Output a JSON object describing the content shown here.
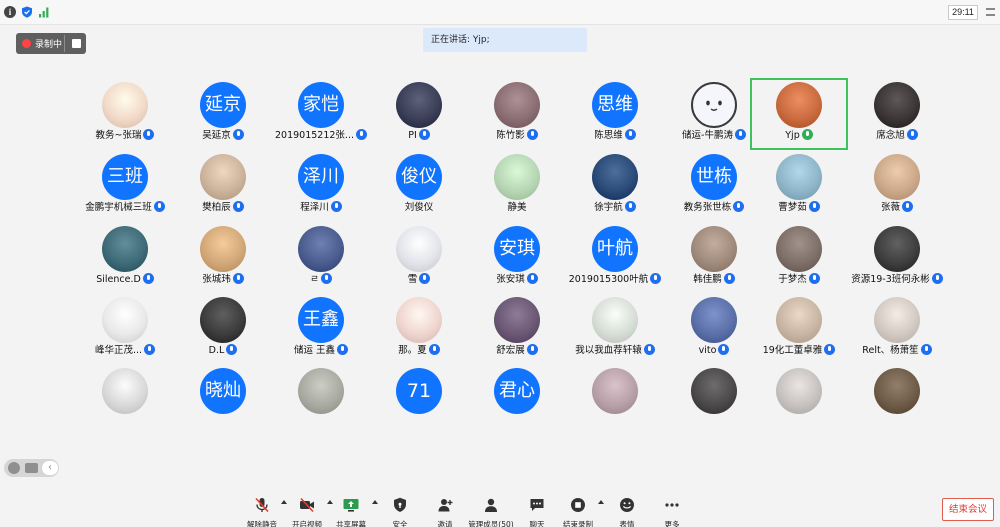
{
  "status_bar": {
    "timer": "29:11"
  },
  "recording": {
    "label": "录制中"
  },
  "speaking": {
    "text": "正在讲话: Yjp;"
  },
  "participants": [
    {
      "name": "教务~张瑞",
      "avatar": "photo",
      "color": "#f2d9c8"
    },
    {
      "name": "吴延京",
      "avatar": "text",
      "text": "延京"
    },
    {
      "name": "2019015212张...",
      "avatar": "text",
      "text": "家恺"
    },
    {
      "name": "PI",
      "avatar": "photo",
      "color": "#3a3f57"
    },
    {
      "name": "陈竹影",
      "avatar": "photo",
      "color": "#8a6e73"
    },
    {
      "name": "陈思维",
      "avatar": "text",
      "text": "思维"
    },
    {
      "name": "储运-牛鹏涛",
      "avatar": "face",
      "color": "#f4f6fb"
    },
    {
      "name": "Yjp",
      "avatar": "photo",
      "color": "#c96b3f",
      "active": true
    },
    {
      "name": "席念旭",
      "avatar": "photo",
      "color": "#3b3536"
    },
    {
      "name": "金鹏宇机械三班",
      "avatar": "text",
      "text": "三班"
    },
    {
      "name": "樊柏辰",
      "avatar": "photo",
      "color": "#cbb39c"
    },
    {
      "name": "程泽川",
      "avatar": "text",
      "text": "泽川"
    },
    {
      "name": "刘俊仪",
      "avatar": "text",
      "text": "俊仪",
      "no_mic": true
    },
    {
      "name": "静美",
      "avatar": "photo",
      "color": "#b7d6b3",
      "no_mic": true
    },
    {
      "name": "徐宇航",
      "avatar": "photo",
      "color": "#2a4b77"
    },
    {
      "name": "教务张世栋",
      "avatar": "text",
      "text": "世栋"
    },
    {
      "name": "曹梦茹",
      "avatar": "photo",
      "color": "#8fb5c9"
    },
    {
      "name": "张薇",
      "avatar": "photo",
      "color": "#caa889"
    },
    {
      "name": "Silence.D",
      "avatar": "photo",
      "color": "#3f6a77"
    },
    {
      "name": "张城玮",
      "avatar": "photo",
      "color": "#d3a879"
    },
    {
      "name": "ㄹ",
      "avatar": "photo",
      "color": "#4a5d8e"
    },
    {
      "name": "雪",
      "avatar": "photo",
      "color": "#e2e4ea"
    },
    {
      "name": "张安琪",
      "avatar": "text",
      "text": "安琪"
    },
    {
      "name": "2019015300叶航",
      "avatar": "text",
      "text": "叶航"
    },
    {
      "name": "韩佳鹏",
      "avatar": "photo",
      "color": "#a08a7c"
    },
    {
      "name": "于梦杰",
      "avatar": "photo",
      "color": "#7e6f68"
    },
    {
      "name": "资源19-3班何永彬",
      "avatar": "photo",
      "color": "#3e3e3e"
    },
    {
      "name": "峰华正茂...",
      "avatar": "photo",
      "color": "#e9e9e9"
    },
    {
      "name": "D.L",
      "avatar": "photo",
      "color": "#3c3c3c"
    },
    {
      "name": "储运 王鑫",
      "avatar": "text",
      "text": "王鑫"
    },
    {
      "name": "那。夏",
      "avatar": "photo",
      "color": "#f0d5cf"
    },
    {
      "name": "舒宏展",
      "avatar": "photo",
      "color": "#6b5874"
    },
    {
      "name": "我以我血荐轩辕",
      "avatar": "photo",
      "color": "#d7ded6"
    },
    {
      "name": "vito",
      "avatar": "photo",
      "color": "#5b6fa8"
    },
    {
      "name": "19化工董卓雅",
      "avatar": "photo",
      "color": "#c9b5a3"
    },
    {
      "name": "Relt、杨萧笙",
      "avatar": "photo",
      "color": "#d3c9c3"
    },
    {
      "name": "",
      "avatar": "photo",
      "color": "#d9d9d9"
    },
    {
      "name": "",
      "avatar": "text",
      "text": "晓灿"
    },
    {
      "name": "",
      "avatar": "photo",
      "color": "#a9aaa1"
    },
    {
      "name": "",
      "avatar": "text",
      "text": "71"
    },
    {
      "name": "",
      "avatar": "text",
      "text": "君心"
    },
    {
      "name": "",
      "avatar": "photo",
      "color": "#b7a0a7"
    },
    {
      "name": "",
      "avatar": "photo",
      "color": "#4b4949"
    },
    {
      "name": "",
      "avatar": "photo",
      "color": "#c7c2bf"
    },
    {
      "name": "",
      "avatar": "photo",
      "color": "#6e5b48"
    }
  ],
  "toolbar": {
    "unmute": "解除静音",
    "start_video": "开启视频",
    "share_screen": "共享屏幕",
    "security": "安全",
    "invite": "邀请",
    "manage": "管理成员(50)",
    "chat": "聊天",
    "end_recording": "结束录制",
    "reactions": "表情",
    "more": "更多",
    "end_meeting": "结束会议"
  }
}
